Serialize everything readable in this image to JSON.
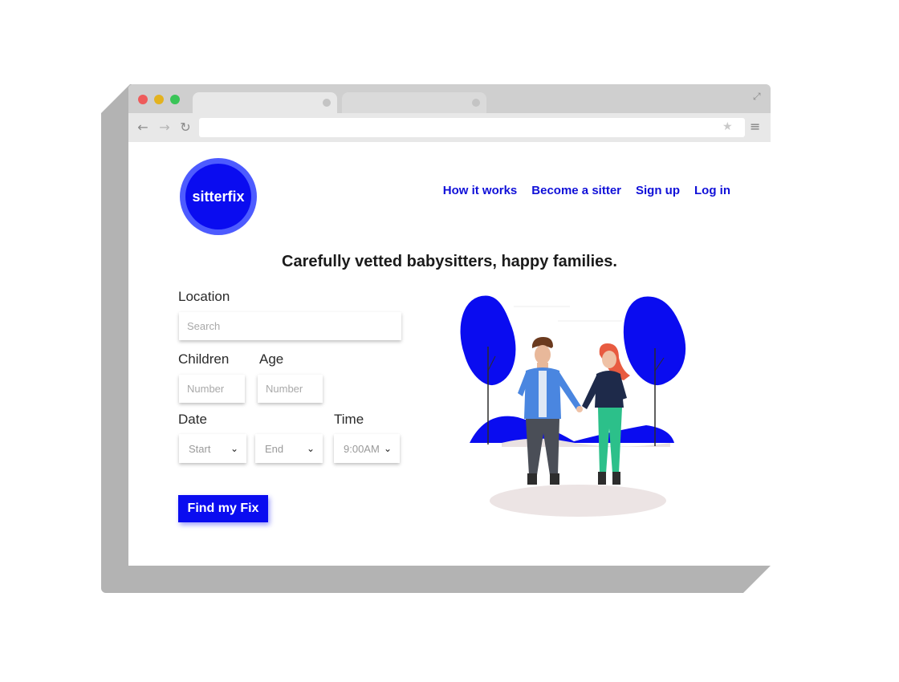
{
  "brand": {
    "logo_text": "sitterfix",
    "primary_color": "#0a0cf0"
  },
  "nav": [
    {
      "label": "How it works"
    },
    {
      "label": "Become a sitter"
    },
    {
      "label": "Sign up"
    },
    {
      "label": "Log in"
    }
  ],
  "headline": "Carefully vetted babysitters, happy families.",
  "form": {
    "location_label": "Location",
    "location_placeholder": "Search",
    "children_label": "Children",
    "children_placeholder": "Number",
    "age_label": "Age",
    "age_placeholder": "Number",
    "date_label": "Date",
    "date_start": "Start",
    "date_end": "End",
    "time_label": "Time",
    "time_value": "9:00AM",
    "submit_label": "Find my Fix"
  },
  "icons": {
    "back": "arrow-left-icon",
    "forward": "arrow-right-icon",
    "reload": "reload-icon",
    "star": "star-icon",
    "menu": "menu-icon",
    "expand": "expand-icon",
    "chevron": "chevron-down-icon"
  }
}
